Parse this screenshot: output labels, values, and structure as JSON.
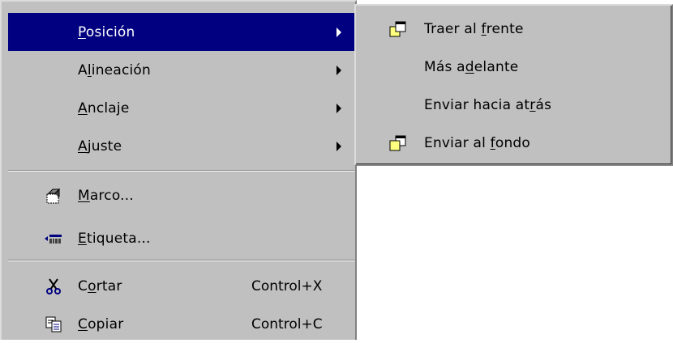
{
  "main_menu": {
    "items": [
      {
        "pre": "",
        "u": "P",
        "post": "osición",
        "submenu": true,
        "active": true
      },
      {
        "pre": "A",
        "u": "l",
        "post": "ineación",
        "submenu": true
      },
      {
        "pre": "",
        "u": "A",
        "post": "nclaje",
        "submenu": true
      },
      {
        "pre": "",
        "u": "A",
        "post": "juste",
        "submenu": true
      },
      {
        "pre": "",
        "u": "M",
        "post": "arco...",
        "icon": "frame-properties-icon"
      },
      {
        "pre": "",
        "u": "E",
        "post": "tiqueta...",
        "icon": "label-icon"
      },
      {
        "pre": "C",
        "u": "o",
        "post": "rtar",
        "icon": "scissors-icon",
        "shortcut": "Control+X"
      },
      {
        "pre": "",
        "u": "C",
        "post": "opiar",
        "icon": "copy-icon",
        "shortcut": "Control+C"
      }
    ]
  },
  "sub_menu": {
    "items": [
      {
        "pre": "Traer al ",
        "u": "f",
        "post": "rente",
        "icon": "bring-to-front-icon"
      },
      {
        "pre": "Más a",
        "u": "d",
        "post": "elante"
      },
      {
        "pre": "Enviar hacia at",
        "u": "r",
        "post": "ás"
      },
      {
        "pre": "Enviar al ",
        "u": "f",
        "post": "ondo",
        "icon": "send-to-back-icon"
      }
    ]
  },
  "colors": {
    "menu_bg": "#c0c0c0",
    "highlight": "#000080",
    "highlight_text": "#ffffff"
  }
}
